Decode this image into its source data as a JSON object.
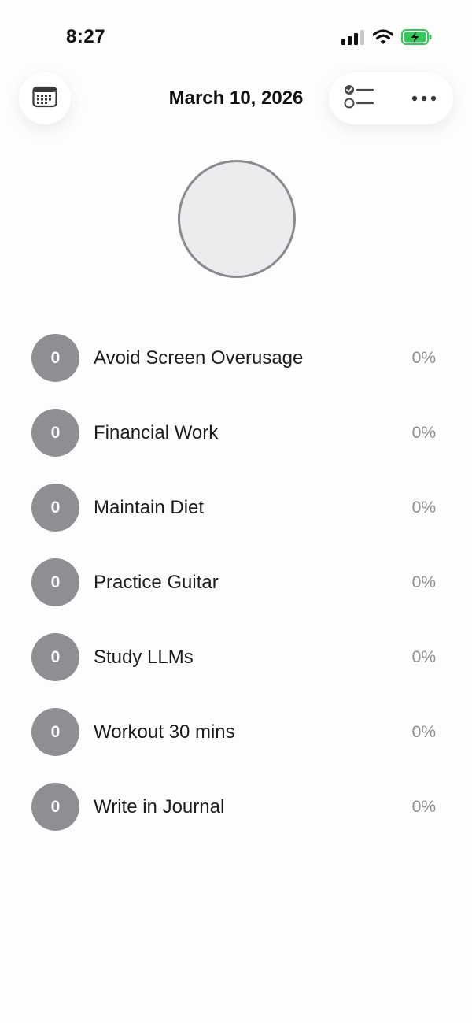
{
  "status_bar": {
    "time": "8:27",
    "icons": [
      "cellular-signal-icon",
      "wifi-icon",
      "battery-charging-icon"
    ],
    "battery_color": "#34c759"
  },
  "header": {
    "title": "March 10, 2026",
    "left_icon": "calendar-icon",
    "right_icons": [
      "checklist-icon",
      "more-icon"
    ]
  },
  "summary": {
    "ring_color": "#8a8a8e",
    "fill_color": "#ececef"
  },
  "habits": [
    {
      "count": "0",
      "name": "Avoid Screen Overusage",
      "percent": "0%"
    },
    {
      "count": "0",
      "name": "Financial Work",
      "percent": "0%"
    },
    {
      "count": "0",
      "name": "Maintain Diet",
      "percent": "0%"
    },
    {
      "count": "0",
      "name": "Practice Guitar",
      "percent": "0%"
    },
    {
      "count": "0",
      "name": "Study LLMs",
      "percent": "0%"
    },
    {
      "count": "0",
      "name": "Workout 30 mins",
      "percent": "0%"
    },
    {
      "count": "0",
      "name": "Write in Journal",
      "percent": "0%"
    }
  ]
}
